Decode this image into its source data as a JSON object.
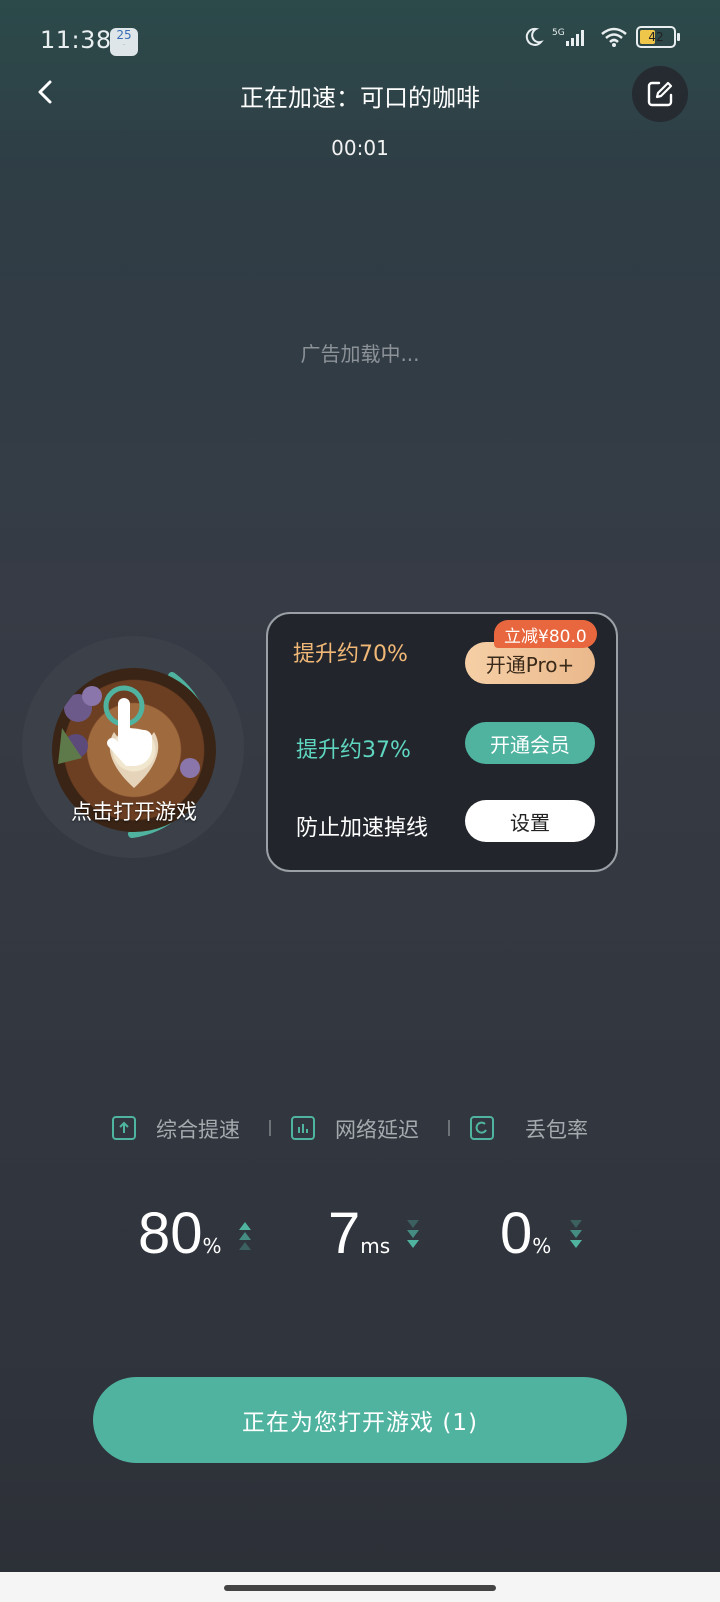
{
  "status_bar": {
    "time": "11:38",
    "date_badge": "25",
    "battery": "42"
  },
  "header": {
    "title": "正在加速：可口的咖啡",
    "timer": "00:01"
  },
  "ad": {
    "loading_text": "广告加载中..."
  },
  "game": {
    "open_label": "点击打开游戏"
  },
  "boost_card": {
    "rows": [
      {
        "label": "提升约70%",
        "button": "开通Pro+",
        "badge": "立减¥80.0"
      },
      {
        "label": "提升约37%",
        "button": "开通会员"
      },
      {
        "label": "防止加速掉线",
        "button": "设置"
      }
    ]
  },
  "stats": {
    "labels": [
      "综合提速",
      "网络延迟",
      "丢包率"
    ],
    "values": [
      {
        "value": "80",
        "unit": "%"
      },
      {
        "value": "7",
        "unit": "ms"
      },
      {
        "value": "0",
        "unit": "%"
      }
    ]
  },
  "cta": {
    "label": "正在为您打开游戏 (1)"
  },
  "colors": {
    "accent": "#4fb3a0",
    "gold": "#f0b777",
    "teal_text": "#5fd6c0",
    "badge": "#e8673e"
  }
}
